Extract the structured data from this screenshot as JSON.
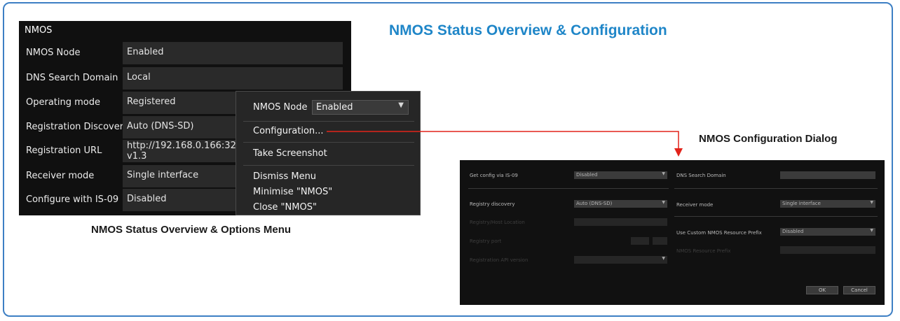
{
  "title": "NMOS Status Overview & Configuration",
  "status_panel": {
    "header": "NMOS",
    "rows": [
      {
        "label": "NMOS Node",
        "value": "Enabled"
      },
      {
        "label": "DNS Search Domain",
        "value": "Local"
      },
      {
        "label": "Operating mode",
        "value": "Registered"
      },
      {
        "label": "Registration Discovery",
        "value": "Auto (DNS-SD)"
      },
      {
        "label": "Registration URL",
        "value": "http://192.168.0.166:321\nv1.3"
      },
      {
        "label": "Receiver mode",
        "value": "Single interface"
      },
      {
        "label": "Configure with IS-09",
        "value": "Disabled"
      }
    ]
  },
  "options_menu": {
    "node_label": "NMOS Node",
    "node_value": "Enabled",
    "items": [
      "Configuration...",
      "Take Screenshot",
      "Dismiss Menu",
      "Minimise \"NMOS\"",
      "Close \"NMOS\""
    ]
  },
  "captions": {
    "status": "NMOS Status Overview & Options Menu",
    "dialog": "NMOS Configuration Dialog"
  },
  "config_dialog": {
    "left": {
      "get_config_label": "Get config via IS-09",
      "get_config_value": "Disabled",
      "registry_discovery_label": "Registry discovery",
      "registry_discovery_value": "Auto (DNS-SD)",
      "registry_location_label": "Registry/Host Location",
      "registry_port_label": "Registry port",
      "registry_api_label": "Registration API version"
    },
    "right": {
      "dns_label": "DNS Search Domain",
      "receiver_mode_label": "Receiver mode",
      "receiver_mode_value": "Single interface",
      "custom_prefix_label": "Use Custom NMOS Resource Prefix",
      "custom_prefix_value": "Disabled",
      "prefix_label": "NMOS Resource Prefix"
    },
    "ok_label": "OK",
    "cancel_label": "Cancel"
  },
  "colors": {
    "title": "#1f86c8",
    "frame_border": "#3d7fc4",
    "arrow": "#e2231a",
    "panel_bg": "#101010",
    "menu_bg": "#262626",
    "dialog_bg": "#111111"
  },
  "icons": {
    "dropdown": "chevron-down-icon",
    "arrow_head": "arrow-down-icon"
  }
}
